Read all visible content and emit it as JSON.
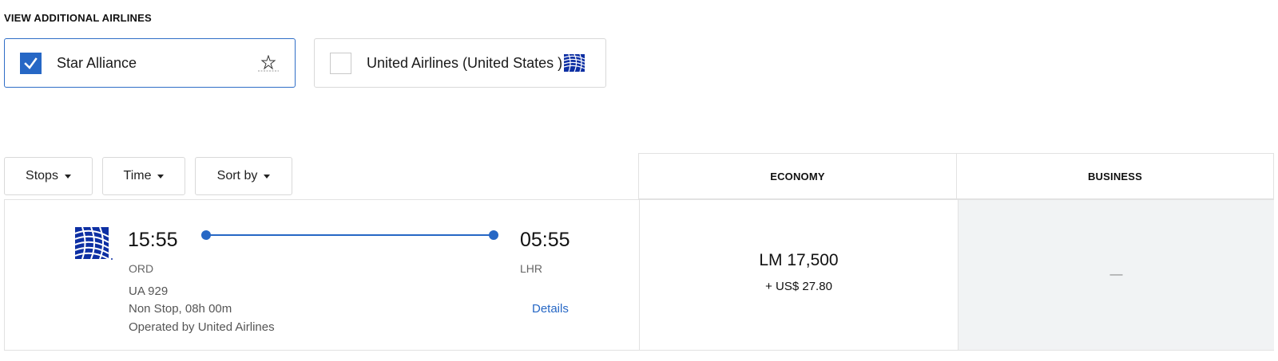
{
  "additional_airlines": {
    "title": "VIEW ADDITIONAL AIRLINES",
    "options": [
      {
        "label": "Star Alliance",
        "checked": true,
        "logo": "star-alliance-logo"
      },
      {
        "label": "United Airlines (United States )",
        "checked": false,
        "logo": "united-airlines-globe-logo"
      }
    ]
  },
  "filters": {
    "stops": "Stops",
    "time": "Time",
    "sort_by": "Sort by"
  },
  "cabins": {
    "economy": "ECONOMY",
    "business": "BUSINESS"
  },
  "flight": {
    "departure_time": "15:55",
    "departure_airport": "ORD",
    "arrival_time": "05:55",
    "arrival_airport": "LHR",
    "flight_number": "UA 929",
    "stops_duration": "Non Stop, 08h 00m",
    "operated_by": "Operated by United Airlines",
    "details_label": "Details",
    "economy_miles": "LM 17,500",
    "economy_fee": "+ US$ 27.80",
    "business_price": "—"
  },
  "colors": {
    "accent": "#2667c5",
    "united_blue": "#0d2fa3",
    "business_bg": "#f1f3f4"
  }
}
